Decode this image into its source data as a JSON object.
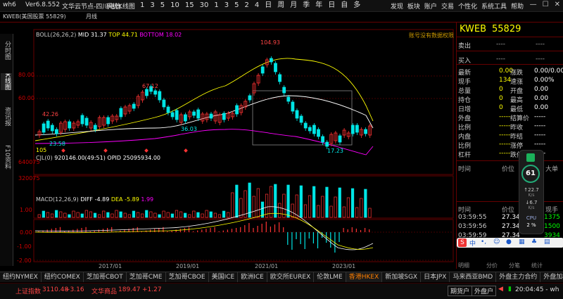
{
  "app": {
    "name": "wh6",
    "version": "Ver6.8.552",
    "server": "文华云节点-四川电信",
    "module": "系统K线图"
  },
  "timeframes": [
    "1",
    "3",
    "5",
    "10",
    "15",
    "30",
    "1",
    "3",
    "5",
    "2",
    "4",
    "日",
    "周",
    "月",
    "季",
    "年",
    "日",
    "自",
    "多"
  ],
  "titlebar_menu": [
    "发现",
    "板块",
    "账户",
    "交易",
    "个性化",
    "系统工具",
    "帮助"
  ],
  "toolbar": {
    "symbol_label": "KWEB(美国股票 55829)",
    "period": "月线"
  },
  "vtabs": [
    "分时图",
    "K线图",
    "资讯报",
    "F10资料"
  ],
  "main_indicator": {
    "name": "BOLL(26,26,2)",
    "mid_label": "MID",
    "mid": "31.37",
    "top_label": "TOP",
    "top": "44.71",
    "bottom_label": "BOTTOM",
    "bottom": "18.02",
    "note": "账号没有数据权限"
  },
  "y_axis_main": [
    "80.00",
    "60.00"
  ],
  "price_labels": {
    "high": "104.93",
    "h2": "67.12",
    "h3": "42.26",
    "l1": "23.58",
    "l2": "36.03",
    "l3": "17.23"
  },
  "volume_indicator": {
    "name": "CJL(0)",
    "value": "920146.00(49:51)",
    "opid_label": "OPID",
    "opid": "25095934.00",
    "ticks": [
      "640075",
      "320075"
    ],
    "count": "105"
  },
  "macd_indicator": {
    "name": "MACD(12,26,9)",
    "diff_label": "DIFF",
    "diff": "-4.89",
    "dea_label": "DEA",
    "dea": "-5.89",
    "macd": "1.99",
    "ticks": [
      "1.00",
      "0.00",
      "-1.00",
      "-2.00"
    ]
  },
  "x_axis": [
    "2017/01",
    "2019/01",
    "2021/01",
    "2023/01"
  ],
  "quote": {
    "code": "KWEB",
    "number": "55829",
    "sell_label": "卖出",
    "sell": "----",
    "sell2": "----",
    "buy_label": "买入",
    "buy": "----",
    "buy2": "----",
    "fields": [
      {
        "l": "最新",
        "v": "0.00",
        "l2": "涨跌",
        "v2": "0.00/0.00%"
      },
      {
        "l": "现手",
        "v": "134",
        "l2": "速涨",
        "v2": "0.00%"
      },
      {
        "l": "总量",
        "v": "0",
        "l2": "开盘",
        "v2": "0.00"
      },
      {
        "l": "持仓",
        "v": "0",
        "l2": "最高",
        "v2": "0.00"
      },
      {
        "l": "日增",
        "v": "0",
        "l2": "最低",
        "v2": "0.00"
      },
      {
        "l": "外盘",
        "v": "-----",
        "l2": "结算价",
        "v2": "-----"
      },
      {
        "l": "比例",
        "v": "-----",
        "l2": "昨收",
        "v2": "-----"
      },
      {
        "l": "内盘",
        "v": "-----",
        "l2": "昨结",
        "v2": "-----"
      },
      {
        "l": "比例",
        "v": "-----",
        "l2": "涨停",
        "v2": "-----"
      },
      {
        "l": "杠杆",
        "v": "-----",
        "l2": "跌停",
        "v2": "-----"
      }
    ],
    "tick_headers": [
      "时间",
      "价位",
      "大单"
    ],
    "trade_headers": [
      "时间",
      "价位",
      "现手"
    ],
    "trades": [
      {
        "t": "03:59:55",
        "p": "27.34",
        "q": "1375"
      },
      {
        "t": "03:59:56",
        "p": "27.34",
        "q": "1500"
      },
      {
        "t": "03:59:59",
        "p": "27.34",
        "q": "3934"
      }
    ],
    "bottom_tabs": [
      "明细",
      "分价",
      "分笔",
      "统计"
    ]
  },
  "widget": {
    "pct": "61",
    "up": "22.7",
    "up_unit": "K/s",
    "down": "6.7",
    "down_unit": "K/s",
    "cpu_label": "CPU",
    "cpu": "2",
    "cpu_unit": "%"
  },
  "ime_bar": {
    "s_label": "S",
    "mode": "中"
  },
  "exchange_tabs": [
    "纽约NYMEX",
    "纽约COMEX",
    "芝加哥CBOT",
    "芝加哥CME",
    "芝加哥CBOE",
    "美国ICE",
    "欧洲ICE",
    "欧交所EUREX",
    "伦敦LME",
    "香港HKEX",
    "新加坡SGX",
    "日本JPX",
    "马来西亚BMD",
    "外盘主力合约",
    "外盘加权"
  ],
  "active_exchange": "香港HKEX",
  "status": {
    "idx1_label": "上证指数",
    "idx1": "3110.48",
    "idx1_chg": "+3.16",
    "idx2_label": "文华商品",
    "idx2": "189.47",
    "idx2_chg": "+1.27",
    "btn1": "期货户",
    "btn2": "外盘户",
    "time": "20:04:45 - wh"
  },
  "colors": {
    "up": "#ff3333",
    "down": "#00e5e5",
    "boll_mid": "#ffffff",
    "boll_top": "#ffff00",
    "boll_bottom": "#ff00ff",
    "accent": "#ff7f00"
  }
}
